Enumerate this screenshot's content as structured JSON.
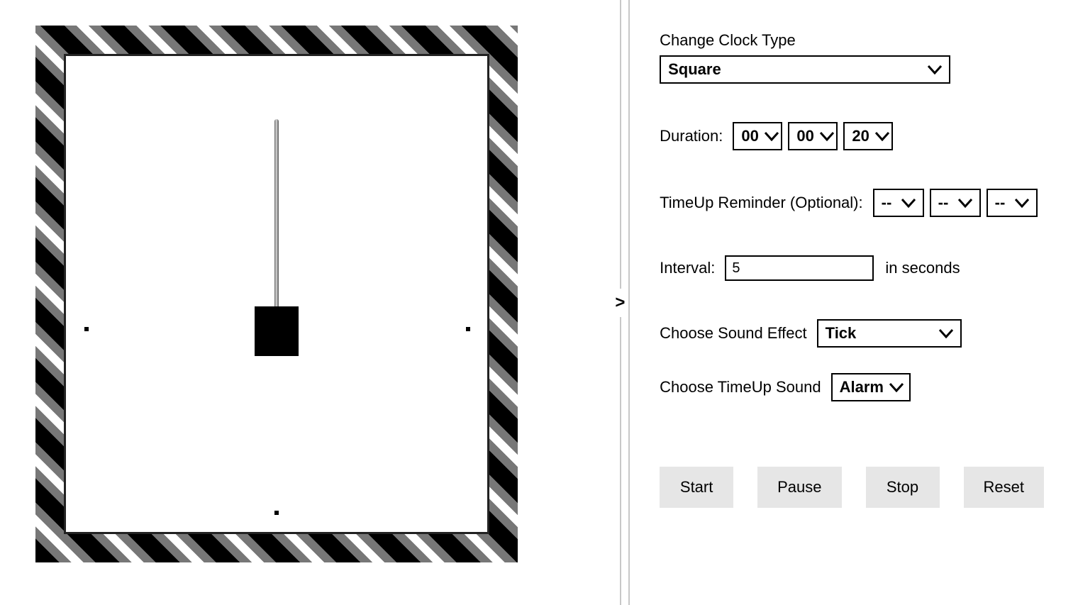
{
  "collapse_glyph": ">",
  "clock_type": {
    "label": "Change Clock Type",
    "value": "Square"
  },
  "duration": {
    "label": "Duration:",
    "hh": "00",
    "mm": "00",
    "ss": "20"
  },
  "timeup_reminder": {
    "label": "TimeUp Reminder (Optional):",
    "hh": "--",
    "mm": "--",
    "ss": "--"
  },
  "interval": {
    "label": "Interval:",
    "value": "5",
    "unit": "in seconds"
  },
  "sound_effect": {
    "label": "Choose Sound Effect",
    "value": "Tick"
  },
  "timeup_sound": {
    "label": "Choose TimeUp Sound",
    "value": "Alarm"
  },
  "buttons": {
    "start": "Start",
    "pause": "Pause",
    "stop": "Stop",
    "reset": "Reset"
  }
}
